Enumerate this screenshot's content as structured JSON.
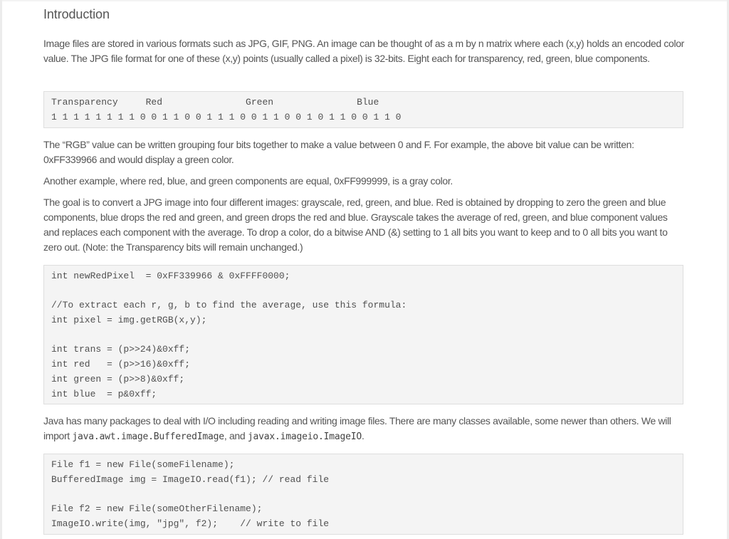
{
  "section": {
    "title": "Introduction"
  },
  "paragraphs": {
    "p1": "Image files are stored in various formats such as JPG, GIF, PNG. An image can be thought of as a m by n matrix where each (x,y) holds an encoded color value. The JPG file format for one of these (x,y) points (usually called a pixel) is 32-bits. Eight each for transparency, red, green, blue components.",
    "p2": "The “RGB” value can be written grouping four bits together to make a value between 0 and F. For example, the above bit value can be written: 0xFF339966 and would display a green color.",
    "p3": "Another example, where red, blue, and green components are equal, 0xFF999999, is a gray color.",
    "p4": "The goal is to convert a JPG image into four different images: grayscale, red, green, and blue. Red is obtained by dropping to zero the green and blue components, blue drops the red and green, and green drops the red and blue. Grayscale takes the average of red, green, and blue component values and replaces each component with the average. To drop a color, do a bitwise AND (&) setting to 1 all bits you want to keep and to 0 all bits you want to zero out. (Note: the Transparency bits will remain unchanged.)",
    "p5_before": "Java has many packages to deal with I/O including reading and writing image files. There are many classes available, some newer than others. We will import ",
    "p5_code1": "java.awt.image.BufferedImage",
    "p5_mid": ", and ",
    "p5_code2": "javax.imageio.ImageIO",
    "p5_after": "."
  },
  "bit_table": {
    "header": "Transparency     Red               Green               Blue",
    "bits": "1 1 1 1 1 1 1 1 0 0 1 1 0 0 1 1 1 0 0 1 1 0 0 1 0 1 1 0 0 1 1 0"
  },
  "code_block_1": {
    "lines": [
      "int newRedPixel  = 0xFF339966 & 0xFFFF0000;",
      "",
      "//To extract each r, g, b to find the average, use this formula:",
      "int pixel = img.getRGB(x,y);",
      "",
      "int trans = (p>>24)&0xff;",
      "int red   = (p>>16)&0xff;",
      "int green = (p>>8)&0xff;",
      "int blue  = p&0xff;"
    ]
  },
  "code_block_2": {
    "lines": [
      "File f1 = new File(someFilename);",
      "BufferedImage img = ImageIO.read(f1); // read file",
      "",
      "File f2 = new File(someOtherFilename);",
      "ImageIO.write(img, \"jpg\", f2);    // write to file"
    ]
  }
}
